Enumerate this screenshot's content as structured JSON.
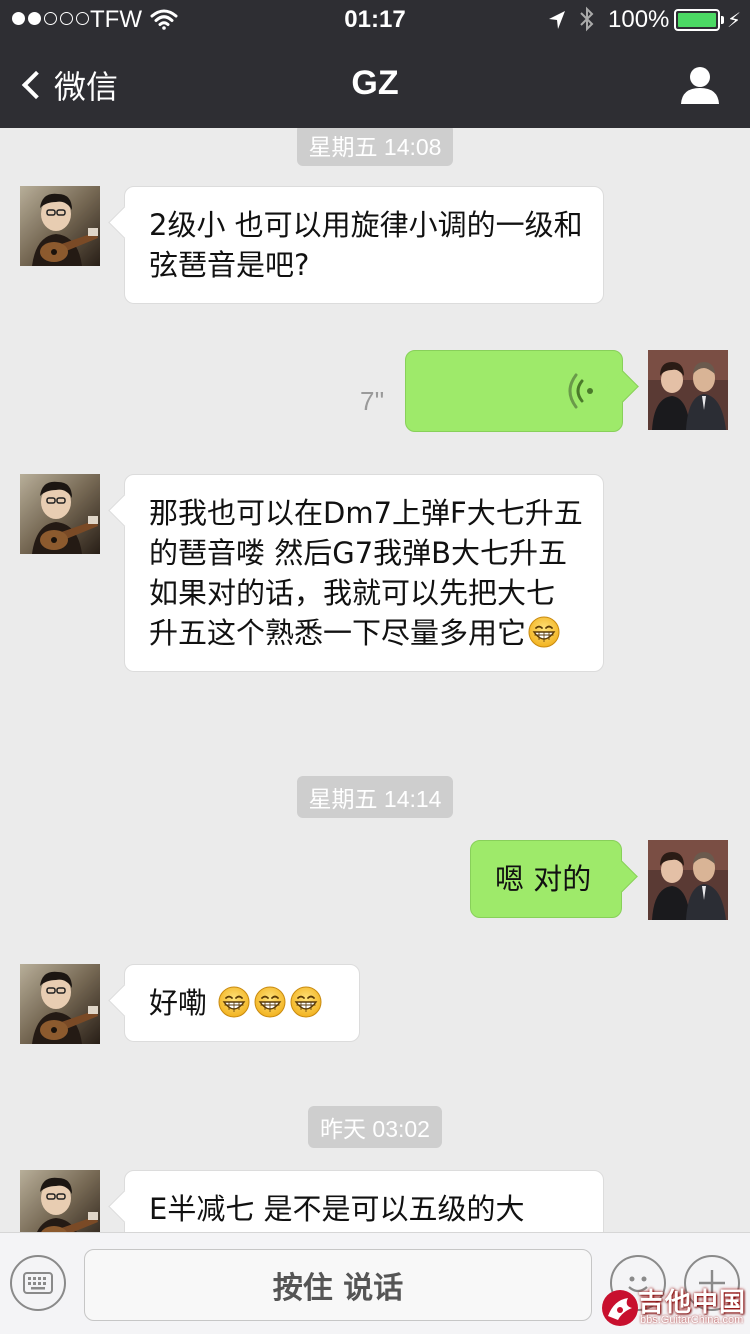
{
  "status_bar": {
    "carrier": "TFW",
    "signal_bars_filled": 2,
    "signal_bars_total": 5,
    "time": "01:17",
    "battery_percent": "100%",
    "battery_color": "#4cd964"
  },
  "nav": {
    "back_label": "微信",
    "title": "GZ",
    "profile_icon": "person-icon"
  },
  "messages": [
    {
      "type": "timestamp",
      "text": "星期五 14:08"
    },
    {
      "type": "text",
      "from": "other",
      "text": "2级小 也可以用旋律小调的一级和弦琶音是吧?"
    },
    {
      "type": "voice",
      "from": "me",
      "duration": "7''"
    },
    {
      "type": "text",
      "from": "other",
      "text": "那我也可以在Dm7上弹F大七升五的琶音喽 然后G7我弹B大七升五 如果对的话，我就可以先把大七升五这个熟悉一下尽量多用它",
      "trailing_emoji": "grin-emoji"
    },
    {
      "type": "timestamp",
      "text": "星期五 14:14"
    },
    {
      "type": "text",
      "from": "me",
      "text": "嗯 对的"
    },
    {
      "type": "text",
      "from": "other",
      "text": "好嘞 ",
      "emoji_count": 3
    },
    {
      "type": "timestamp",
      "text": "昨天 03:02"
    },
    {
      "type": "text",
      "from": "other",
      "text": "E半减七 是不是可以五级的大"
    }
  ],
  "input_bar": {
    "hold_to_talk_label": "按住 说话",
    "left_icon": "keyboard-icon",
    "emoji_icon": "smiley-icon",
    "plus_icon": "plus-icon"
  },
  "watermark": {
    "title": "吉他中国",
    "url": "bbs.GuitarChina.com"
  },
  "colors": {
    "nav_bg": "#2e2e33",
    "chat_bg": "#ebebeb",
    "out_bubble": "#9eea6a",
    "in_bubble": "#ffffff"
  }
}
